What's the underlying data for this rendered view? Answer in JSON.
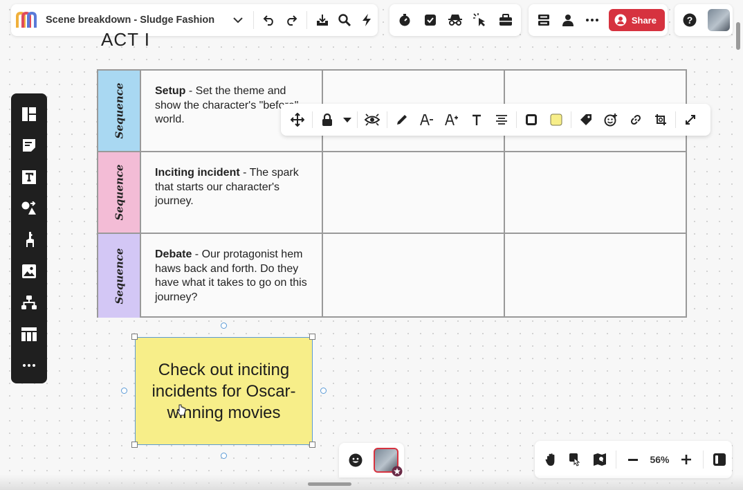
{
  "app": {
    "title": "Scene breakdown - Sludge Fashion",
    "share_label": "Share",
    "accent": "#d6323f"
  },
  "canvas": {
    "act_label": "ACT I",
    "rows": [
      {
        "tag": "Sequence",
        "tag_color": "#a9d8f2",
        "title": "Setup",
        "text": " - Set the theme and show the character's \"before\" world."
      },
      {
        "tag": "Sequence",
        "tag_color": "#f3bcd6",
        "title": "Inciting incident",
        "text": " - The spark that starts our character's journey."
      },
      {
        "tag": "Sequence",
        "tag_color": "#d3c7f5",
        "title": "Debate",
        "text": " - Our protagonist hem haws back and forth. Do they have what it takes to go on this journey?"
      }
    ],
    "sticky": {
      "text": "Check out inciting incidents for Oscar-winning movies",
      "color": "#f7ee89"
    }
  },
  "zoom": {
    "value": "56%"
  },
  "icons": {
    "top": [
      "logo-icon",
      "chevron-down-icon",
      "undo-icon",
      "redo-icon",
      "export-icon",
      "search-icon",
      "lightning-icon",
      "timer-icon",
      "checkbox-icon",
      "incognito-icon",
      "cursor-click-icon",
      "toolbox-icon",
      "layout-icon",
      "user-icon",
      "more-icon",
      "help-icon"
    ],
    "left": [
      "templates-icon",
      "sticky-note-icon",
      "text-icon",
      "shapes-icon",
      "llama-icon",
      "image-icon",
      "mindmap-icon",
      "table-icon",
      "more-icon"
    ],
    "context": [
      "move-icon",
      "lock-icon",
      "caret-down-icon",
      "visibility-icon",
      "pen-icon",
      "font-decrease-icon",
      "font-increase-icon",
      "text-style-icon",
      "align-icon",
      "border-icon",
      "fill-color-icon",
      "tag-icon",
      "add-reaction-icon",
      "link-icon",
      "crop-icon",
      "expand-icon"
    ]
  }
}
